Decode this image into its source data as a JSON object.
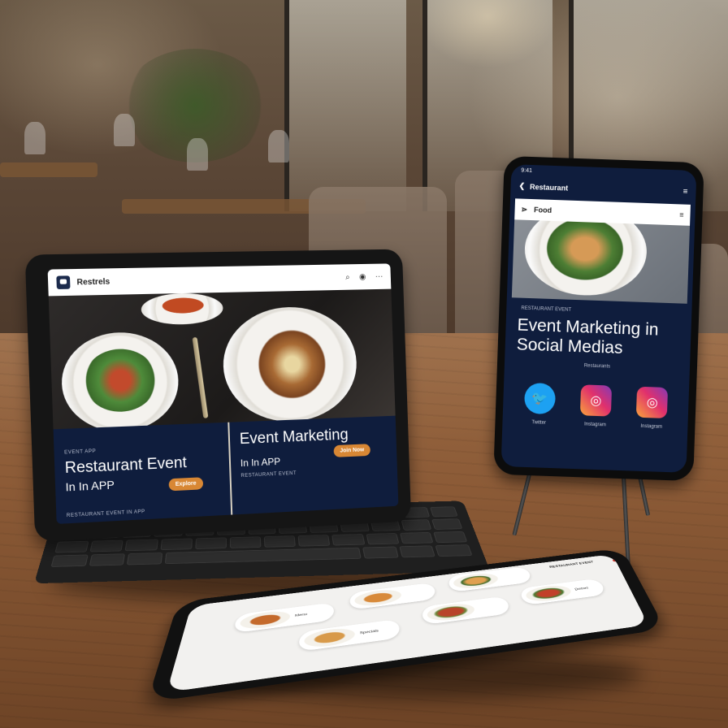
{
  "tablet": {
    "brand": "Restrels",
    "header_icons": [
      "⌕",
      "◉",
      "⋯"
    ],
    "left_small": "EVENT APP",
    "left_title": "Restaurant Event",
    "left_sub": "In In APP",
    "left_button": "Explore",
    "right_title": "Event Marketing",
    "right_sub": "In In APP",
    "right_small": "RESTAURANT EVENT",
    "right_button": "Join Now",
    "footer_small": "RESTAURANT EVENT IN APP"
  },
  "phone": {
    "status": "9:41",
    "top_title": "Restaurant",
    "menu_icon": "≡",
    "bar_title": "Food",
    "small": "RESTAURANT EVENT",
    "title": "Event Marketing in Social Medias",
    "sub": "Restaurants",
    "socials": [
      {
        "icon": "twitter-icon",
        "label": "Twitter"
      },
      {
        "icon": "instagram-icon",
        "label": "Instagram"
      },
      {
        "icon": "instagram-icon",
        "label": "Instagram"
      }
    ]
  },
  "flat_phone": {
    "top_right": "RESTAURANT EVENT",
    "card_labels": [
      "Menu",
      "Specials",
      "Dishes"
    ]
  },
  "colors": {
    "navy": "#0f1d3d",
    "accent": "#d88734",
    "twitter": "#1da1f2"
  }
}
